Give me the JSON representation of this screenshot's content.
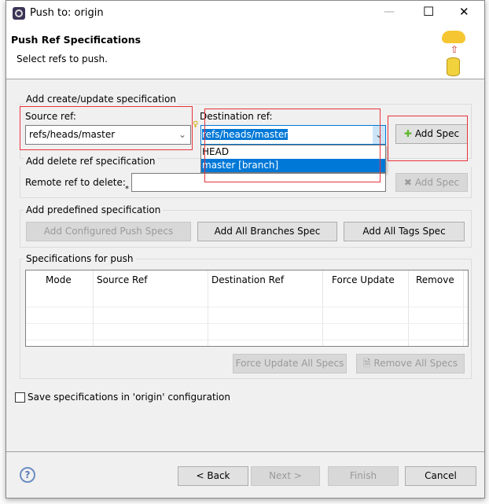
{
  "window": {
    "title": "Push to: origin",
    "minimize": "—",
    "maximize": "☐",
    "close": "✕"
  },
  "header": {
    "title": "Push Ref Specifications",
    "subtitle": "Select refs to push."
  },
  "create_group": {
    "label": "Add create/update specification",
    "source_label": "Source ref:",
    "source_value": "refs/heads/master",
    "dest_label": "Destination ref:",
    "dest_value": "refs/heads/master",
    "add_spec": "Add Spec",
    "dropdown_options": [
      "HEAD",
      "master [branch]"
    ],
    "selected_option": "master [branch]"
  },
  "delete_group": {
    "label": "Add delete ref specification",
    "remote_label": "Remote ref to delete:",
    "remote_value": "",
    "add_spec": "Add Spec"
  },
  "predefined_group": {
    "label": "Add predefined specification",
    "configured": "Add Configured Push Specs",
    "all_branches": "Add All Branches Spec",
    "all_tags": "Add All Tags Spec"
  },
  "specs_group": {
    "label": "Specifications for push",
    "columns": [
      "Mode",
      "Source Ref",
      "Destination Ref",
      "Force Update",
      "Remove"
    ],
    "force_all": "Force Update All Specs",
    "remove_all": "Remove All Specs"
  },
  "save_checkbox": {
    "label": "Save specifications in 'origin' configuration",
    "checked": false
  },
  "footer": {
    "back": "< Back",
    "next": "Next >",
    "finish": "Finish",
    "cancel": "Cancel"
  },
  "colors": {
    "selection": "#0078d7",
    "highlight_box": "#e8333a"
  }
}
